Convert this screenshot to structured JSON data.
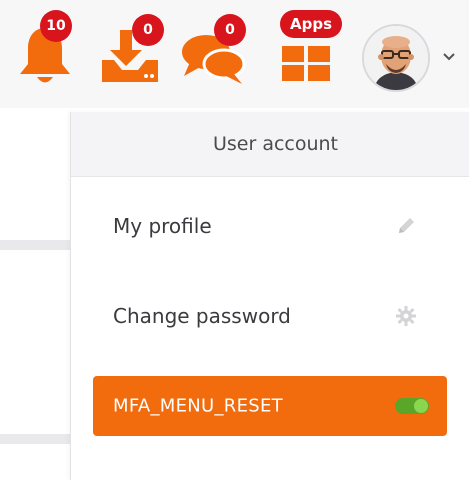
{
  "header": {
    "notifications": {
      "icon": "bell-icon",
      "badge": "10"
    },
    "downloads": {
      "icon": "download-tray-icon",
      "badge": "0"
    },
    "messages": {
      "icon": "chat-bubbles-icon",
      "badge": "0"
    },
    "apps": {
      "icon": "apps-grid-icon",
      "badge": "Apps"
    },
    "user": {
      "icon": "avatar",
      "menu_icon": "chevron-down-icon"
    }
  },
  "dropdown": {
    "title": "User account",
    "items": [
      {
        "label": "My profile",
        "icon": "pencil-icon"
      },
      {
        "label": "Change password",
        "icon": "gear-icon"
      },
      {
        "label": "MFA_MENU_RESET",
        "icon": "toggle-switch",
        "state": "on"
      }
    ]
  },
  "colors": {
    "accent_orange": "#f26c0d",
    "badge_red": "#d8141c",
    "toggle_green": "#5aa628"
  }
}
